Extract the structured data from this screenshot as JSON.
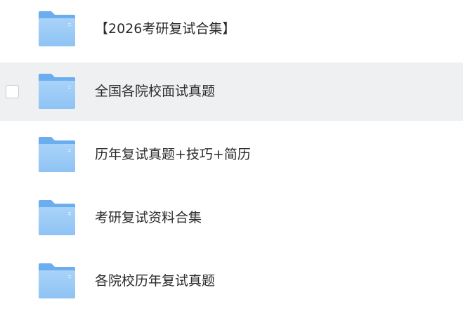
{
  "file_list": {
    "items": [
      {
        "name": "【2026考研复试合集】",
        "icon": "folder-icon",
        "hovered": false
      },
      {
        "name": "全国各院校面试真题",
        "icon": "folder-icon",
        "hovered": true
      },
      {
        "name": "历年复试真题+技巧+简历",
        "icon": "folder-icon",
        "hovered": false
      },
      {
        "name": "考研复试资料合集",
        "icon": "folder-icon",
        "hovered": false
      },
      {
        "name": "各院校历年复试真题",
        "icon": "folder-icon",
        "hovered": false
      }
    ]
  },
  "colors": {
    "hover_background": "#eff0f2",
    "folder_back": "#6aaef0",
    "folder_front": "#9fcdf7",
    "text": "#2c2c2c"
  }
}
